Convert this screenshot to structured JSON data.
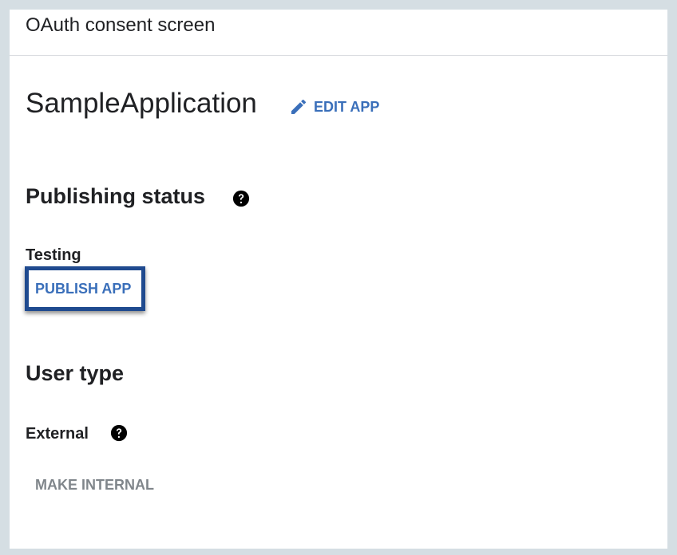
{
  "header": {
    "title": "OAuth consent screen"
  },
  "app": {
    "name": "SampleApplication",
    "edit_label": "EDIT APP",
    "edit_icon": "pencil-icon"
  },
  "publishing": {
    "title": "Publishing status",
    "help_icon": "help-circle-icon",
    "status": "Testing",
    "publish_label": "PUBLISH APP"
  },
  "user_type": {
    "title": "User type",
    "value": "External",
    "help_icon": "help-circle-icon",
    "make_internal_label": "MAKE INTERNAL"
  },
  "colors": {
    "accent": "#3a6fba",
    "highlight_frame": "#1f4a8f",
    "disabled_text": "#80868b",
    "background": "#d5dee3"
  }
}
